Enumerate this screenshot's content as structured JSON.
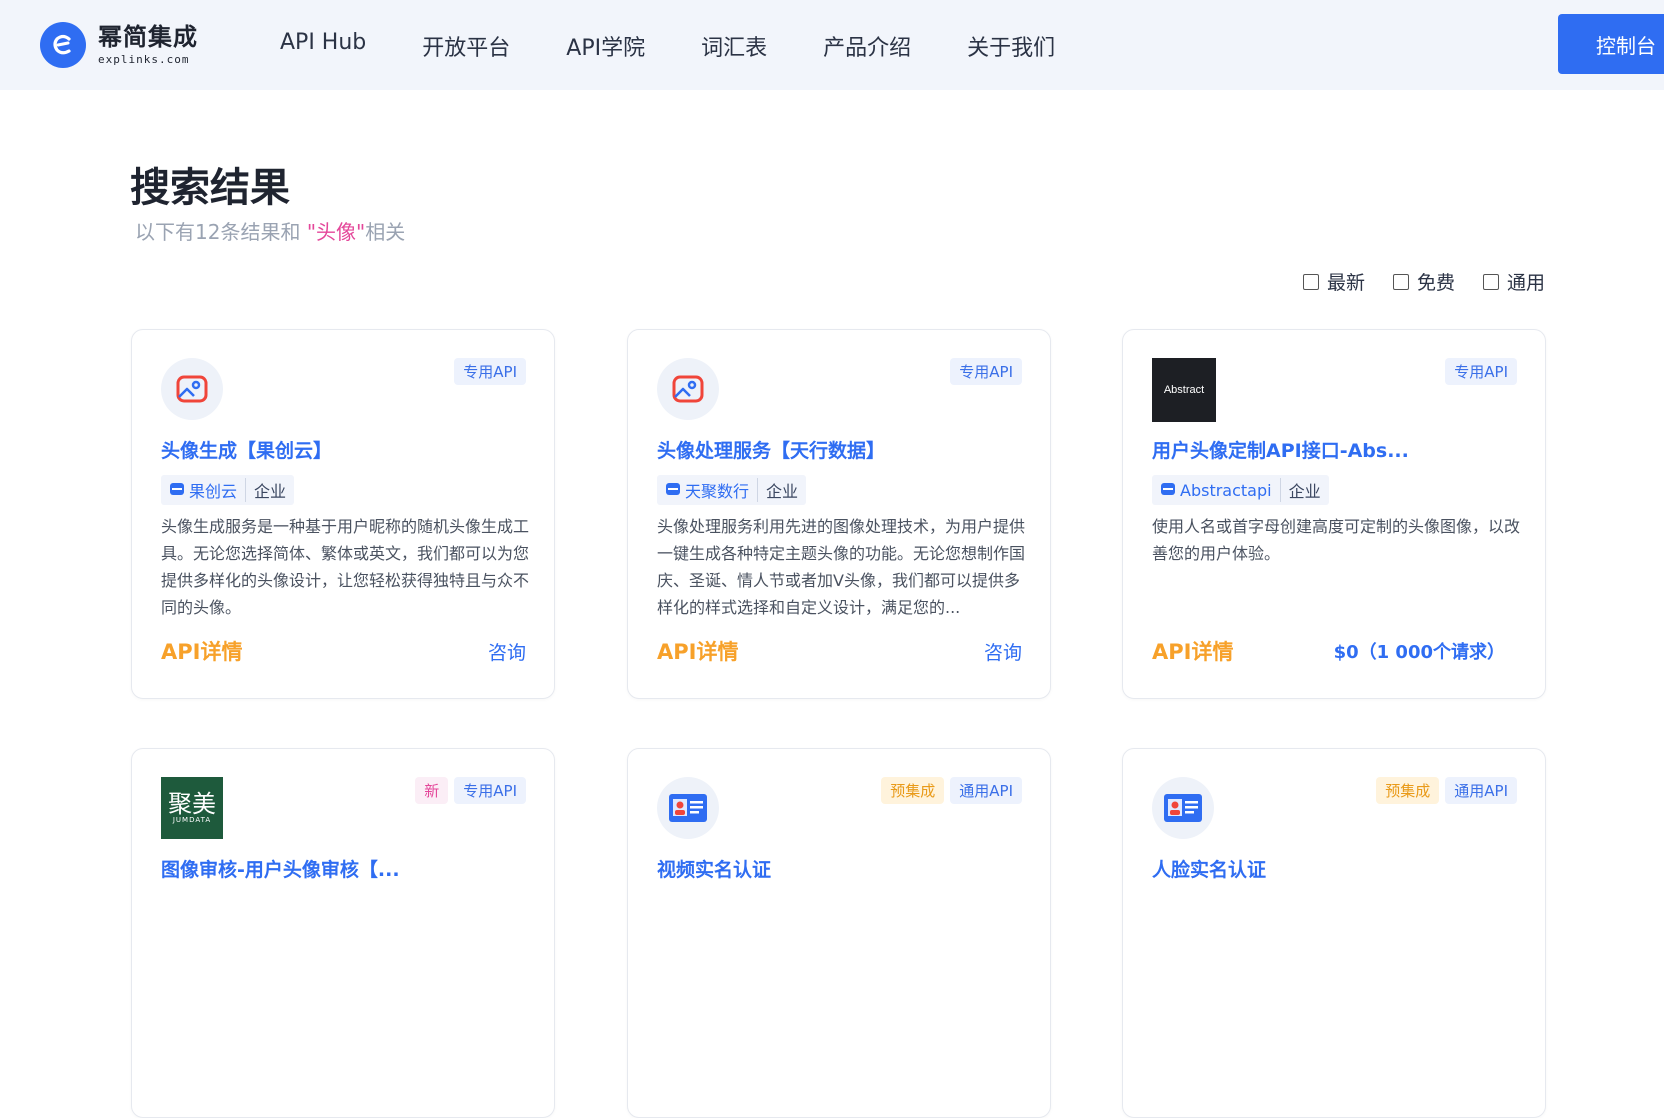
{
  "header": {
    "logo_cn": "幂简集成",
    "logo_en": "explinks.com",
    "nav": [
      "API Hub",
      "开放平台",
      "API学院",
      "词汇表",
      "产品介绍",
      "关于我们"
    ],
    "console_label": "控制台"
  },
  "search": {
    "title": "搜索结果",
    "subtitle_prefix": "以下有12条结果和 ",
    "keyword": "\"头像\"",
    "subtitle_suffix": "相关"
  },
  "filters": [
    {
      "label": "最新",
      "checked": false
    },
    {
      "label": "免费",
      "checked": false
    },
    {
      "label": "通用",
      "checked": false
    }
  ],
  "cards": [
    {
      "icon": "image-avatar-icon",
      "badges": [
        "专用API"
      ],
      "title": "头像生成【果创云】",
      "org": "果创云",
      "org_type": "企业",
      "desc": "头像生成服务是一种基于用户昵称的随机头像生成工具。无论您选择简体、繁体或英文，我们都可以为您提供多样化的头像设计，让您轻松获得独特且与众不同的头像。",
      "detail_label": "API详情",
      "action": "咨询"
    },
    {
      "icon": "image-avatar-icon",
      "badges": [
        "专用API"
      ],
      "title": "头像处理服务【天行数据】",
      "org": "天聚数行",
      "org_type": "企业",
      "desc": "头像处理服务利用先进的图像处理技术，为用户提供一键生成各种特定主题头像的功能。无论您想制作国庆、圣诞、情人节或者加V头像，我们都可以提供多样化的样式选择和自定义设计，满足您的...",
      "detail_label": "API详情",
      "action": "咨询"
    },
    {
      "icon": "abstract-logo",
      "logo_text": "Abstract",
      "badges": [
        "专用API"
      ],
      "title": "用户头像定制API接口-Abs...",
      "org": "Abstractapi",
      "org_type": "企业",
      "desc": "使用人名或首字母创建高度可定制的头像图像，以改善您的用户体验。",
      "detail_label": "API详情",
      "price": "$0（1 000个请求）"
    },
    {
      "icon": "jumei-logo",
      "logo_text": "聚美",
      "logo_sub": "JUMDATA",
      "badges": [
        "新",
        "专用API"
      ],
      "title": "图像审核-用户头像审核【..."
    },
    {
      "icon": "id-card-icon",
      "badges": [
        "预集成",
        "通用API"
      ],
      "title": "视频实名认证"
    },
    {
      "icon": "id-card-icon",
      "badges": [
        "预集成",
        "通用API"
      ],
      "title": "人脸实名认证"
    }
  ],
  "colors": {
    "brand": "#2f6df2",
    "accent_orange": "#f7a12a",
    "keyword_pink": "#e4479a"
  }
}
